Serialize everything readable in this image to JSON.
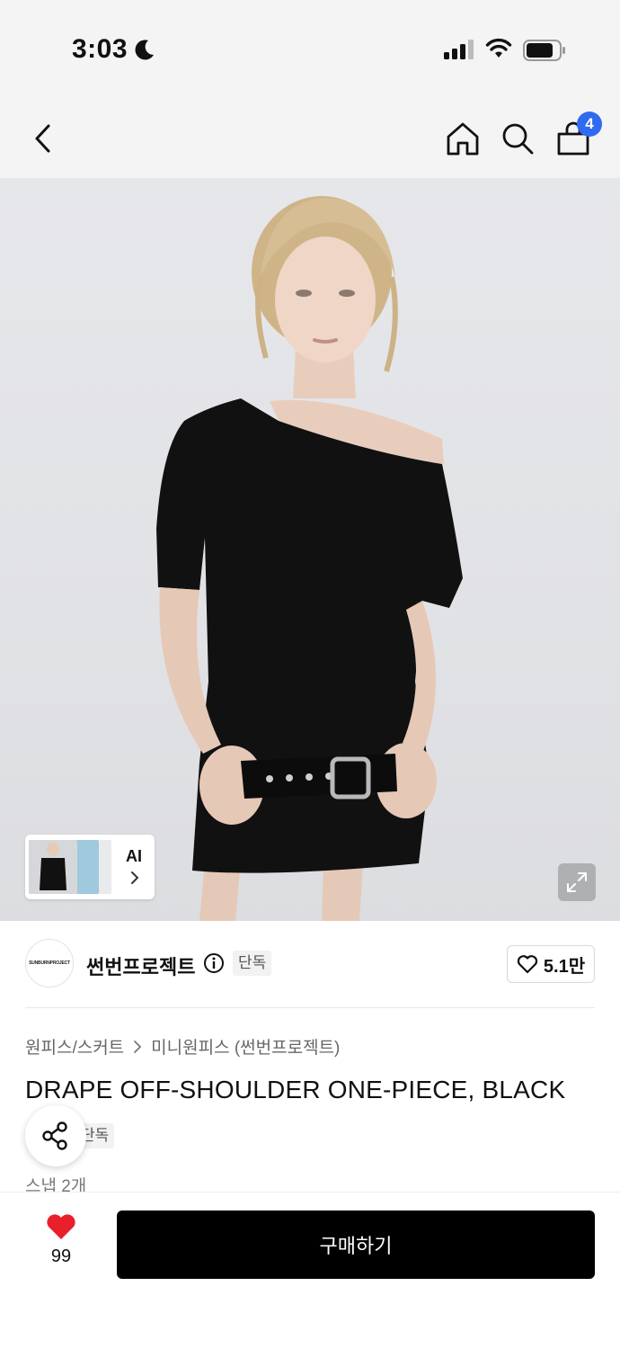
{
  "status_bar": {
    "time": "3:03"
  },
  "nav": {
    "cart_count": "4"
  },
  "hero": {
    "ai_label": "AI"
  },
  "brand": {
    "name": "썬번프로젝트",
    "logo_text": "SUNBURNPROJECT",
    "exclusive_badge": "단독",
    "like_count": "5.1만"
  },
  "breadcrumb": {
    "category": "원피스/스커트",
    "subcategory": "미니원피스 (썬번프로젝트)"
  },
  "product": {
    "title": "DRAPE OFF-SHOULDER ONE-PIECE, BLACK",
    "badge": "단독",
    "snap_count": "스냅 2개"
  },
  "bottom_bar": {
    "heart_count": "99",
    "buy_label": "구매하기"
  },
  "colors": {
    "accent_blue": "#2f6bf0",
    "heart_red": "#e8202b",
    "buy_button": "#000000"
  }
}
